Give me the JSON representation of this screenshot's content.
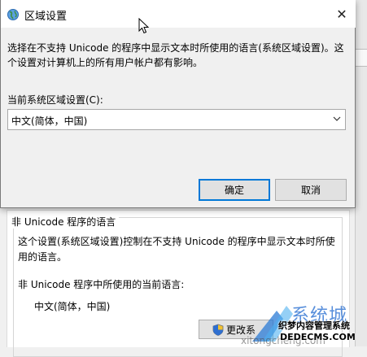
{
  "background": {
    "group_title": "非 Unicode 程序的语言",
    "description_line1": "这个设置(系统区域设置)控制在不支持 Unicode 的程序中显示文本时所使",
    "description_line2": "用的语言。",
    "current_label": "非 Unicode 程序中所使用的当前语言:",
    "current_value": "中文(简体，中国)",
    "change_button_label": "更改系"
  },
  "dialog": {
    "title": "区域设置",
    "close_glyph": "✕",
    "description_line1": "选择在不支持 Unicode 的程序中显示文本时所使用的语言(系统区域设置)。这",
    "description_line2": "个设置对计算机上的所有用户帐户都有影响。",
    "combo_label": "当前系统区域设置(C):",
    "combo_value": "中文(简体，中国)",
    "ok_label": "确定",
    "cancel_label": "取消"
  },
  "watermark": {
    "big": "系统城",
    "small": "织梦内容管理系统",
    "domain": "DEDECMS.COM",
    "faint": "xitongcheng.com"
  },
  "colors": {
    "accent": "#0078d7",
    "watermark_blue": "#3a7bd5"
  },
  "icons": {
    "title_icon": "globe-region-icon",
    "close": "close-icon",
    "combo_arrow": "chevron-down-icon",
    "shield": "uac-shield-icon",
    "cursor": "mouse-pointer-icon"
  }
}
